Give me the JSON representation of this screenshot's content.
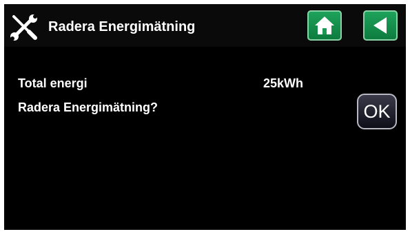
{
  "header": {
    "title": "Radera Energimätning",
    "tools_icon": "wrench-screwdriver-icon",
    "home_icon": "home-icon",
    "back_icon": "back-arrow-icon",
    "accent_color": "#1a9a52"
  },
  "content": {
    "total_label": "Total energi",
    "total_value": "25kWh",
    "question": "Radera Energimätning?",
    "ok_label": "OK"
  }
}
